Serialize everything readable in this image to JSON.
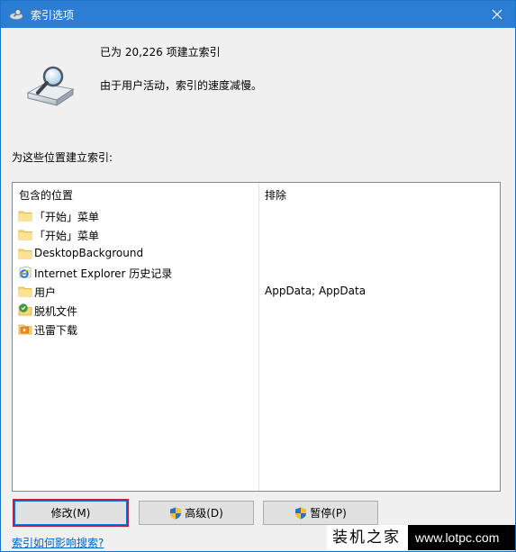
{
  "window": {
    "title": "索引选项"
  },
  "status": {
    "count_text": "已为 20,226 项建立索引",
    "note_text": "由于用户活动，索引的速度减慢。"
  },
  "list": {
    "caption": "为这些位置建立索引:",
    "headers": {
      "included": "包含的位置",
      "excluded": "排除"
    },
    "rows": [
      {
        "name": "「开始」菜单",
        "exclude": "",
        "icon": "folder-icon"
      },
      {
        "name": "「开始」菜单",
        "exclude": "",
        "icon": "folder-icon"
      },
      {
        "name": "DesktopBackground",
        "exclude": "",
        "icon": "folder-icon"
      },
      {
        "name": "Internet Explorer 历史记录",
        "exclude": "",
        "icon": "internet-explorer-icon"
      },
      {
        "name": "用户",
        "exclude": "AppData; AppData",
        "icon": "folder-icon"
      },
      {
        "name": "脱机文件",
        "exclude": "",
        "icon": "offline-files-icon"
      },
      {
        "name": "迅雷下载",
        "exclude": "",
        "icon": "xunlei-folder-icon"
      }
    ]
  },
  "buttons": {
    "modify": "修改(M)",
    "advanced": "高级(D)",
    "pause": "暂停(P)"
  },
  "links": {
    "help": "索引如何影响搜索?"
  },
  "watermark": {
    "brand_cn": "装机之家",
    "url": "www.lotpc.com"
  },
  "colors": {
    "titlebar": "#2b7ed4",
    "link": "#0066cc",
    "focus_outline": "#c0203a"
  }
}
